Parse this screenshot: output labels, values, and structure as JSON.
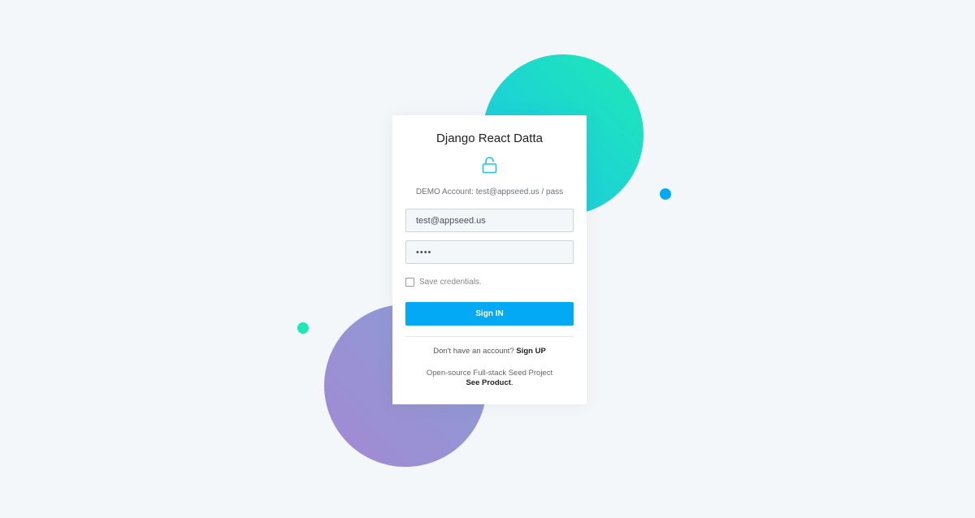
{
  "colors": {
    "background": "#f4f7fa",
    "primary": "#04a9f5",
    "teal_start": "#1dc4e9",
    "teal_end": "#1de9b6",
    "purple_start": "#a389d4",
    "purple_end": "#899ed4",
    "accent_dot_blue": "#04a9f5",
    "accent_dot_green": "#1de9b6"
  },
  "card": {
    "title": "Django React Datta",
    "icon": "unlock-icon",
    "demo_account": "DEMO Account: test@appseed.us / pass"
  },
  "form": {
    "email_value": "test@appseed.us",
    "password_value": "pass",
    "save_credentials_label": "Save credentials.",
    "save_credentials_checked": false,
    "submit_label": "Sign IN"
  },
  "footer": {
    "no_account_text": "Don't have an account?",
    "signup_link": "Sign UP",
    "seed_project_text": "Open-source Full-stack Seed Project",
    "see_product_link": "See Product",
    "see_product_suffix": "."
  }
}
